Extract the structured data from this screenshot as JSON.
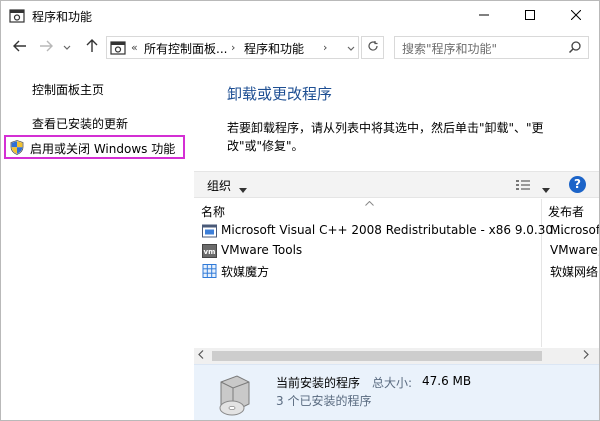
{
  "window": {
    "title": "程序和功能",
    "icons": [
      "control-panel-icon",
      "minimize-icon",
      "maximize-icon",
      "close-icon"
    ]
  },
  "navigation": {
    "back_icon": "arrow-left-icon",
    "forward_icon": "arrow-right-icon",
    "history_icon": "chevron-down-icon",
    "up_icon": "arrow-up-icon",
    "breadcrumb_overflow": "«",
    "breadcrumbs": [
      "所有控制面板...",
      "程序和功能"
    ],
    "breadcrumb_separator": "›",
    "refresh_icon": "refresh-icon",
    "search_placeholder": "搜索\"程序和功能\"",
    "search_icon": "magnifier-icon"
  },
  "sidebar": {
    "home_link": "控制面板主页",
    "updates_link": "查看已安装的更新",
    "features_link": "启用或关闭 Windows 功能",
    "features_icon": "shield-icon",
    "highlight_color": "#d42fd4"
  },
  "main": {
    "heading": "卸载或更改程序",
    "heading_color": "#1e4f93",
    "description": "若要卸载程序，请从列表中将其选中，然后单击\"卸载\"、\"更改\"或\"修复\"。",
    "toolbar": {
      "organize_label": "组织",
      "view_icon": "view-options-icon",
      "help_label": "?"
    },
    "columns": {
      "name": "名称",
      "publisher": "发布者"
    },
    "programs": [
      {
        "name": "Microsoft Visual C++ 2008 Redistributable - x86 9.0.30...",
        "publisher": "Microsof",
        "icon": "installer-icon"
      },
      {
        "name": "VMware Tools",
        "publisher": "VMware,",
        "icon": "vmware-icon"
      },
      {
        "name": "软媒魔方",
        "publisher": "软媒网络",
        "icon": "grid-app-icon"
      }
    ],
    "details": {
      "title": "当前安装的程序",
      "size_label": "总大小:",
      "size_value": "47.6 MB",
      "count_text": "3 个已安装的程序",
      "icon": "software-disk-icon"
    }
  }
}
